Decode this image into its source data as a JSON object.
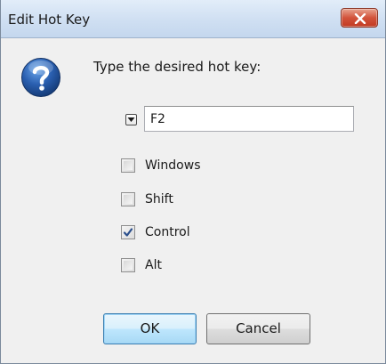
{
  "dialog": {
    "title": "Edit Hot Key",
    "prompt": "Type the desired hot key:",
    "key_value": "F2",
    "modifiers": [
      {
        "label": "Windows",
        "checked": false
      },
      {
        "label": "Shift",
        "checked": false
      },
      {
        "label": "Control",
        "checked": true
      },
      {
        "label": "Alt",
        "checked": false
      }
    ],
    "ok_label": "OK",
    "cancel_label": "Cancel"
  },
  "icons": {
    "title_close": "close-icon",
    "prompt_icon": "question-icon",
    "dropdown": "chevron-down-icon"
  },
  "colors": {
    "close_button": "#c94a32",
    "icon_blue": "#2a5fb0",
    "ok_button": "#bee6fd"
  }
}
